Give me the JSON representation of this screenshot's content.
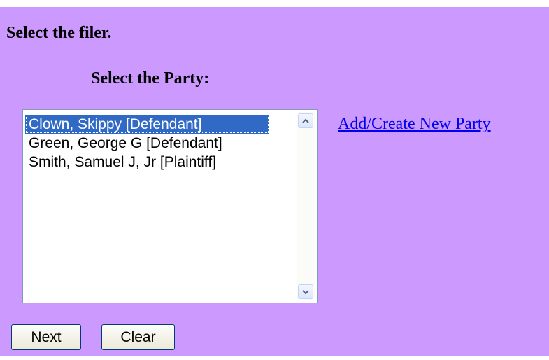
{
  "form": {
    "title": "Select the filer.",
    "party_label": "Select the Party:",
    "parties": [
      {
        "label": "Clown, Skippy [Defendant]",
        "selected": true
      },
      {
        "label": "Green, George G [Defendant]",
        "selected": false
      },
      {
        "label": "Smith, Samuel J, Jr [Plaintiff]",
        "selected": false
      }
    ],
    "add_party_link": "Add/Create New Party",
    "next_button": "Next",
    "clear_button": "Clear"
  },
  "colors": {
    "background": "#cc99ff",
    "selection": "#316ac5",
    "link": "#0000ee"
  },
  "icons": {
    "scroll_up": "chevron-up-icon",
    "scroll_down": "chevron-down-icon"
  }
}
